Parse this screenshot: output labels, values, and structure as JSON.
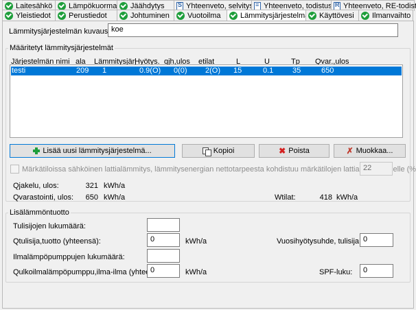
{
  "tabs_row1": [
    {
      "label": "Laitesähkö",
      "icon": "ok-icon"
    },
    {
      "label": "Lämpökuorma",
      "icon": "ok-icon"
    },
    {
      "label": "Jäähdytys",
      "icon": "ok-icon"
    },
    {
      "label": "Yhteenveto, selvitys",
      "icon": "document-icon"
    },
    {
      "label": "Yhteenveto, todistus",
      "icon": "document-icon"
    },
    {
      "label": "Yhteenveto, RE-todistus",
      "icon": "document-icon"
    }
  ],
  "tabs_row2": [
    {
      "label": "Yleistiedot",
      "icon": "ok-icon"
    },
    {
      "label": "Perustiedot",
      "icon": "ok-icon"
    },
    {
      "label": "Johtuminen",
      "icon": "ok-icon"
    },
    {
      "label": "Vuotoilma",
      "icon": "ok-icon"
    },
    {
      "label": "Lämmitysjärjestelmä",
      "icon": "ok-icon",
      "active": true
    },
    {
      "label": "Käyttövesi",
      "icon": "ok-icon"
    },
    {
      "label": "Ilmanvaihto",
      "icon": "ok-icon"
    }
  ],
  "description": {
    "label": "Lämmitysjärjestelmän kuvaus:",
    "value": "koe"
  },
  "systems_group": {
    "title": "Määritetyt lämmitysjärjestelmät",
    "columns": [
      "Järjestelmän nimi",
      "ala",
      "Lämmitysjärj",
      "Hyötys.",
      "qjh,ulos",
      "etilat",
      "L",
      "U",
      "Tp",
      "Qvar.,ulos"
    ],
    "rows": [
      [
        "testi",
        "209",
        "1",
        "0.9(O)",
        "0(0)",
        "2(O)",
        "15",
        "0.1",
        "35",
        "650"
      ]
    ]
  },
  "buttons": {
    "add": "Lisää uusi lämmitysjärjestelmä...",
    "copy": "Kopioi",
    "delete": "Poista",
    "edit": "Muokkaa..."
  },
  "floor_heating": {
    "label": "Märkätiloissa sähköinen lattialämmitys, lämmitysenergian nettotarpeesta kohdistuu märkätilojen lattialämmitykselle (%):",
    "value": "22",
    "checked": false
  },
  "summary": {
    "qjakelu_label": "Qjakelu, ulos:",
    "qjakelu_value": "321",
    "qjakelu_unit": "kWh/a",
    "qvar_label": "Qvarastointi, ulos:",
    "qvar_value": "650",
    "qvar_unit": "kWh/a",
    "wtilat_label": "Wtilat:",
    "wtilat_value": "418",
    "wtilat_unit": "kWh/a"
  },
  "extra_heat": {
    "title": "Lisälämmöntuotto",
    "fireplaces_label": "Tulisijojen lukumäärä:",
    "fireplaces_value": "",
    "qtulisija_label": "Qtulisija,tuotto (yhteensä):",
    "qtulisija_value": "0",
    "qtulisija_unit": "kWh/a",
    "annual_eff_label": "Vuosihyötysuhde, tulisija:",
    "annual_eff_value": "0",
    "heatpumps_label": "Ilmalämpöpumppujen lukumäärä:",
    "heatpumps_value": "",
    "qilp_label": "Qulkoilmalämpöpumppu,ilma-ilma (yhteensä):",
    "qilp_value": "0",
    "qilp_unit": "kWh/a",
    "spf_label": "SPF-luku:",
    "spf_value": "0"
  }
}
